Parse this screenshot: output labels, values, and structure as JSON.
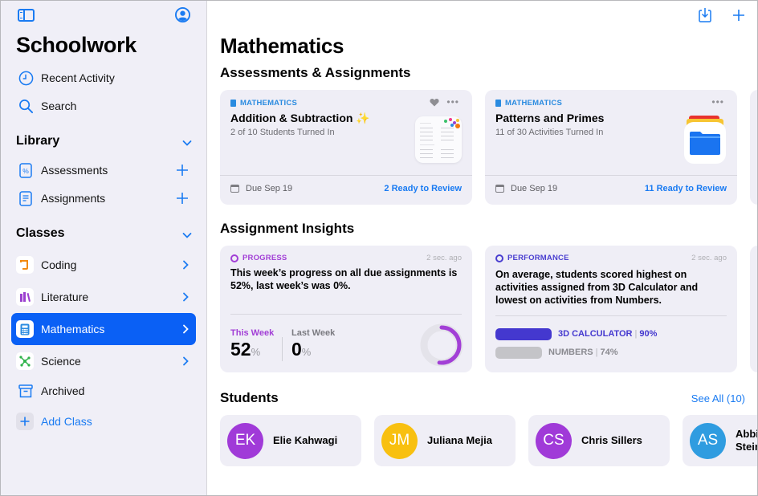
{
  "sidebar": {
    "app_title": "Schoolwork",
    "top_items": [
      {
        "label": "Recent Activity",
        "icon": "clock-icon"
      },
      {
        "label": "Search",
        "icon": "search-icon"
      }
    ],
    "library": {
      "title": "Library",
      "items": [
        {
          "label": "Assessments",
          "icon": "percent-doc-icon"
        },
        {
          "label": "Assignments",
          "icon": "document-icon"
        }
      ]
    },
    "classes": {
      "title": "Classes",
      "items": [
        {
          "label": "Coding",
          "icon": "scroll-icon",
          "icon_color": "#f28a10",
          "selected": false
        },
        {
          "label": "Literature",
          "icon": "books-icon",
          "icon_color": "#9b3fcf",
          "selected": false
        },
        {
          "label": "Mathematics",
          "icon": "calculator-icon",
          "icon_color": "#2a8be0",
          "selected": true
        },
        {
          "label": "Science",
          "icon": "molecule-icon",
          "icon_color": "#2fb34a",
          "selected": false
        }
      ],
      "archived_label": "Archived",
      "add_class_label": "Add Class"
    }
  },
  "main": {
    "page_title": "Mathematics",
    "assignments_section": {
      "title": "Assessments & Assignments",
      "cards": [
        {
          "subject": "MATHEMATICS",
          "title": "Addition & Subtraction",
          "title_suffix": "✨",
          "status": "2 of 10 Students Turned In",
          "due": "Due Sep 19",
          "review": "2 Ready to Review"
        },
        {
          "subject": "MATHEMATICS",
          "title": "Patterns and Primes",
          "status": "11 of 30 Activities Turned In",
          "due": "Due Sep 19",
          "review": "11 Ready to Review"
        }
      ]
    },
    "insights_section": {
      "title": "Assignment Insights",
      "progress": {
        "tag": "PROGRESS",
        "ago": "2 sec. ago",
        "text": "This week’s progress on all due assignments is 52%, last week’s was 0%.",
        "this_week_label": "This Week",
        "this_week_value": "52",
        "last_week_label": "Last Week",
        "last_week_value": "0",
        "percent_sign": "%",
        "ring_fraction": 0.52,
        "accent": "#a23fd6"
      },
      "performance": {
        "tag": "PERFORMANCE",
        "ago": "2 sec. ago",
        "text": "On average, students scored highest on activities assigned from 3D Calculator and lowest on activities from Numbers.",
        "bars": [
          {
            "label": "3D CALCULATOR",
            "value": "90%",
            "fraction": 0.9,
            "color": "#4438cf"
          },
          {
            "label": "NUMBERS",
            "value": "74%",
            "fraction": 0.74,
            "color": "#c4c4c8"
          }
        ],
        "accent": "#4a3fd0"
      }
    },
    "students_section": {
      "title": "Students",
      "see_all": "See All (10)",
      "students": [
        {
          "initials": "EK",
          "name": "Elie Kahwagi",
          "color": "#a03ad8"
        },
        {
          "initials": "JM",
          "name": "Juliana Mejia",
          "color": "#f8c010"
        },
        {
          "initials": "CS",
          "name": "Chris Sillers",
          "color": "#a03ad8"
        },
        {
          "initials": "AS",
          "name": "Abbie Stein",
          "color": "#2f9ce0"
        }
      ]
    }
  },
  "colors": {
    "accent": "#1a7bf2",
    "selected": "#0a60f5",
    "sidebar_bg": "#f0eff7",
    "card_bg": "#efeef6"
  }
}
